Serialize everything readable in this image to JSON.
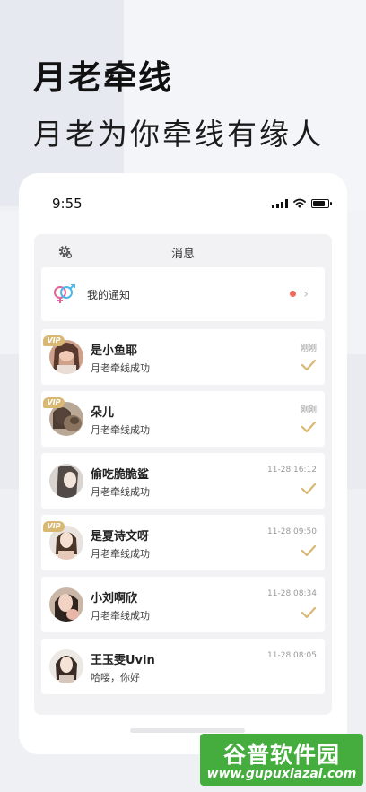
{
  "hero": {
    "title": "月老牵线",
    "subtitle": "月老为你牵线有缘人"
  },
  "status_bar": {
    "time": "9:55",
    "icons": [
      "signal-icon",
      "wifi-icon",
      "battery-icon"
    ]
  },
  "messages": {
    "title": "消息",
    "settings_icon": "gear-icon",
    "notification": {
      "label": "我的通知",
      "icon": "gender-symbol-icon",
      "has_unread": true
    },
    "chats": [
      {
        "name": "是小鱼耶",
        "preview": "月老牵线成功",
        "time": "刚刚",
        "vip": true,
        "vip_label": "VIP",
        "read": true
      },
      {
        "name": "朵儿",
        "preview": "月老牵线成功",
        "time": "刚刚",
        "vip": true,
        "vip_label": "VIP",
        "read": true
      },
      {
        "name": "偷吃脆脆鲨",
        "preview": "月老牵线成功",
        "time": "11-28 16:12",
        "vip": false,
        "read": true
      },
      {
        "name": "是夏诗文呀",
        "preview": "月老牵线成功",
        "time": "11-28 09:50",
        "vip": true,
        "vip_label": "VIP",
        "read": true
      },
      {
        "name": "小刘啊欣",
        "preview": "月老牵线成功",
        "time": "11-28 08:34",
        "vip": false,
        "read": true
      },
      {
        "name": "王玉雯Uvin",
        "preview": "哈喽，你好",
        "time": "11-28 08:05",
        "vip": false,
        "read": false
      }
    ]
  },
  "colors": {
    "accent_gold": "#d8b872",
    "unread_dot": "#ee6a5f",
    "gender_male": "#4cb7e6",
    "gender_female": "#e0649a",
    "watermark_green": "#45ad3d"
  },
  "watermark": {
    "title": "谷普软件园",
    "url": "www.gupuxiazai.com"
  }
}
